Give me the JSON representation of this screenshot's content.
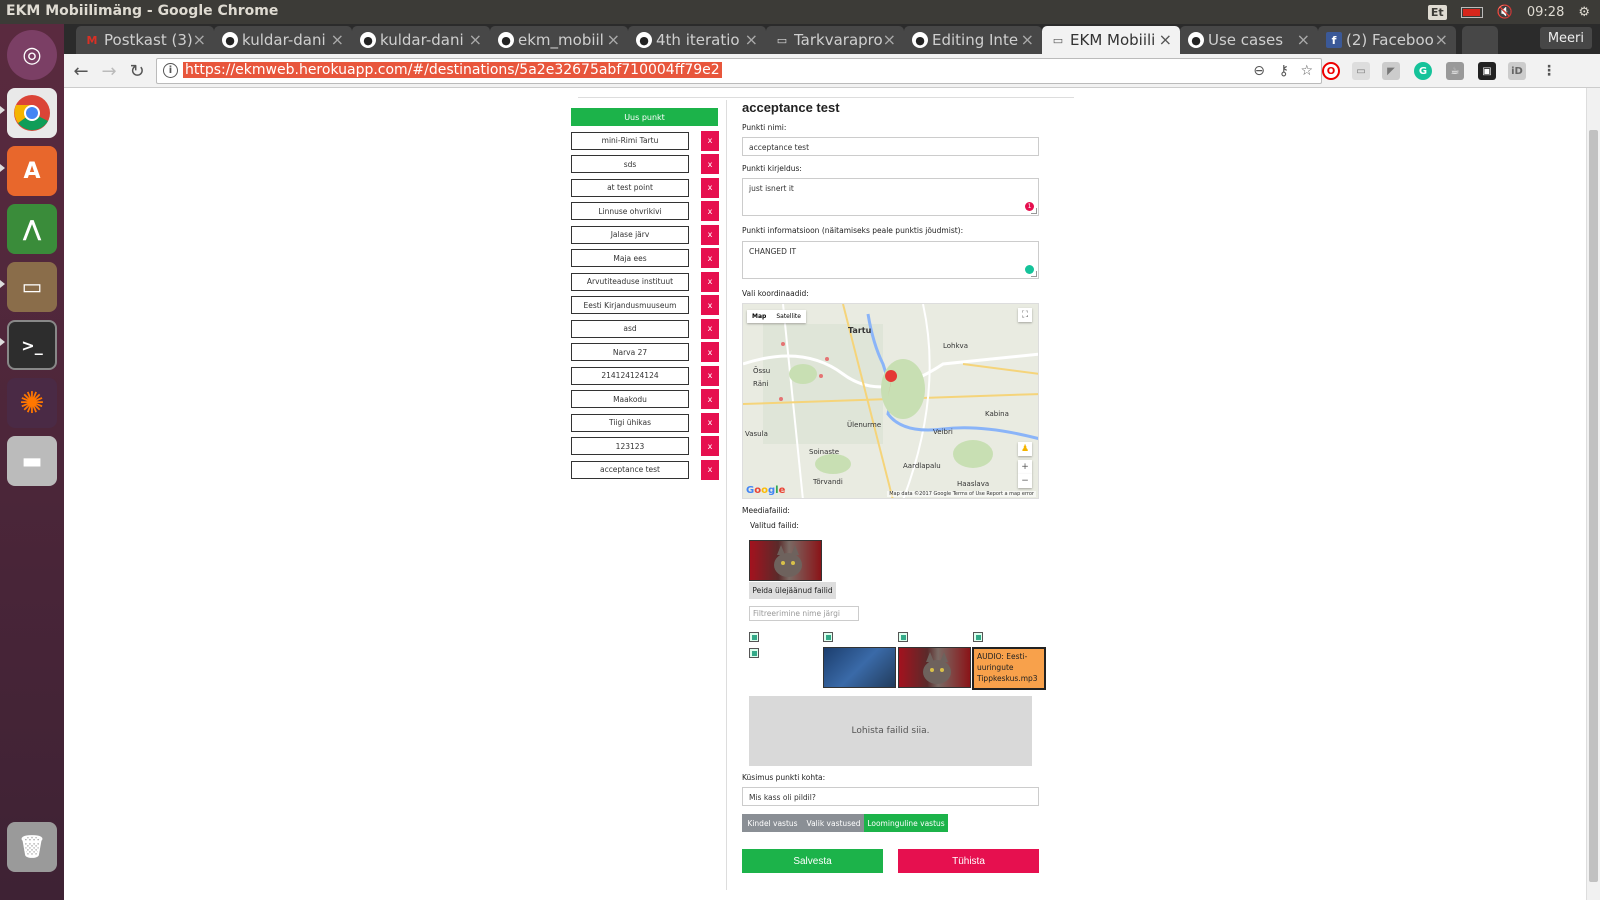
{
  "os": {
    "window_title": "EKM Mobiilimäng - Google Chrome",
    "keyboard_layout": "Et",
    "clock": "09:28"
  },
  "tabs": [
    {
      "label": "Postkast (3)",
      "icon": "gmail-icon",
      "color": "#d93025",
      "glyph": "M"
    },
    {
      "label": "kuldar-dani",
      "icon": "github-icon",
      "color": "#fff",
      "glyph": "●"
    },
    {
      "label": "kuldar-dani",
      "icon": "github-icon",
      "color": "#fff",
      "glyph": "●"
    },
    {
      "label": "ekm_mobiil",
      "icon": "github-icon",
      "color": "#fff",
      "glyph": "●"
    },
    {
      "label": "4th iteratio",
      "icon": "github-icon",
      "color": "#fff",
      "glyph": "●"
    },
    {
      "label": "Tarkvarapro",
      "icon": "document-icon",
      "color": "#fff",
      "glyph": "▭"
    },
    {
      "label": "Editing Inte",
      "icon": "github-icon",
      "color": "#fff",
      "glyph": "●"
    },
    {
      "label": "EKM Mobiili",
      "icon": "document-icon",
      "color": "#555",
      "glyph": "▭",
      "active": true
    },
    {
      "label": "Use cases",
      "icon": "github-icon",
      "color": "#fff",
      "glyph": "●"
    },
    {
      "label": "(2) Faceboo",
      "icon": "facebook-icon",
      "color": "#3b5998",
      "glyph": "f"
    }
  ],
  "profile": "Meeri",
  "url": "https://ekmweb.herokuapp.com/#/destinations/5a2e32675abf710004ff79e2",
  "list": {
    "new_label": "Uus punkt",
    "delete_label": "x",
    "items": [
      "mini-Rimi Tartu",
      "sds",
      "at test point",
      "Linnuse ohvrikivi",
      "Jalase järv",
      "Maja ees",
      "Arvutiteaduse instituut",
      "Eesti Kirjandusmuuseum",
      "asd",
      "Narva 27",
      "214124124124",
      "Maakodu",
      "Tiigi ühikas",
      "123123",
      "acceptance test"
    ]
  },
  "form": {
    "title": "acceptance test",
    "name_label": "Punkti nimi:",
    "name_value": "acceptance test",
    "desc_label": "Punkti kirjeldus:",
    "desc_value": "just isnert it",
    "desc_error_count": "1",
    "info_label": "Punkti informatsioon (näitamiseks peale punktis jõudmist):",
    "info_value": "CHANGED IT",
    "coords_label": "Vali koordinaadid:",
    "media_label": "Meediafailid:",
    "selected_label": "Valitud failid:",
    "hide_btn": "Peida ülejäänud failid",
    "filter_placeholder": "Filtreerimine nime järgi",
    "audio_tile": "AUDIO: Eesti-uuringute Tippkeskus.mp3",
    "drop_zone": "Lohista failid siia.",
    "question_label": "Küsimus punkti kohta:",
    "question_value": "Mis kass oli pildil?",
    "answer_types": [
      "Kindel vastus",
      "Valik vastused",
      "Loominguline vastus"
    ],
    "save": "Salvesta",
    "cancel": "Tühista"
  },
  "map": {
    "type_map": "Map",
    "type_satellite": "Satellite",
    "cities": [
      {
        "name": "Tartu",
        "big": true
      },
      {
        "name": "Lohkva"
      },
      {
        "name": "Õssu"
      },
      {
        "name": "Räni"
      },
      {
        "name": "Kabina"
      },
      {
        "name": "Vasula"
      },
      {
        "name": "Ülenurme"
      },
      {
        "name": "Soinaste"
      },
      {
        "name": "Aardlapalu"
      },
      {
        "name": "Tõrvandi"
      },
      {
        "name": "Veibri"
      },
      {
        "name": "Haaslava"
      }
    ],
    "footer": "Map data ©2017 Google   Terms of Use   Report a map error",
    "logo": "Google"
  },
  "colors": {
    "green": "#1cb34a",
    "red": "#e6104f",
    "grey": "#8a8f95",
    "orange": "#f8a14b"
  }
}
